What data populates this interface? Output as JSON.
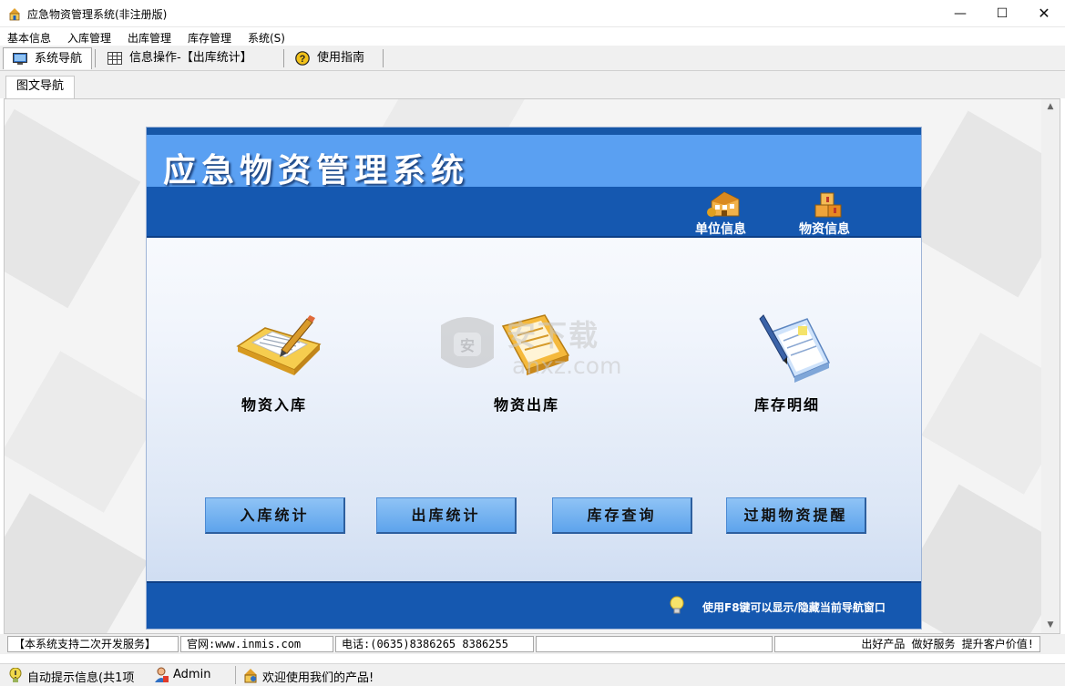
{
  "window": {
    "title": "应急物资管理系统(非注册版)",
    "min": "—",
    "max": "☐",
    "close": "✕"
  },
  "menu": [
    "基本信息",
    "入库管理",
    "出库管理",
    "库存管理",
    "系统(S)"
  ],
  "toolbar": {
    "nav": "系统导航",
    "ops": "信息操作-【出库统计】",
    "guide": "使用指南"
  },
  "tab": "图文导航",
  "panel": {
    "title": "应急物资管理系统",
    "quick_links": [
      "单位信息",
      "物资信息"
    ],
    "modules": [
      "物资入库",
      "物资出库",
      "库存明细"
    ],
    "buttons": [
      "入库统计",
      "出库统计",
      "库存查询",
      "过期物资提醒"
    ],
    "hint": "使用F8键可以显示/隐藏当前导航窗口"
  },
  "watermark": {
    "big": "安下载",
    "small": "anxz.com"
  },
  "status_bar": {
    "cells": [
      "【本系统支持二次开发服务】",
      "官网:www.inmis.com",
      "电话:(0635)8386265 8386255",
      "",
      "出好产品 做好服务 提升客户价值!"
    ],
    "items": [
      "自动提示信息(共1项",
      "Admin",
      "欢迎使用我们的产品!"
    ]
  },
  "colors": {
    "accent": "#1558b0",
    "header_blue": "#5aa0f2",
    "button_blue": "#6aaaf0"
  }
}
